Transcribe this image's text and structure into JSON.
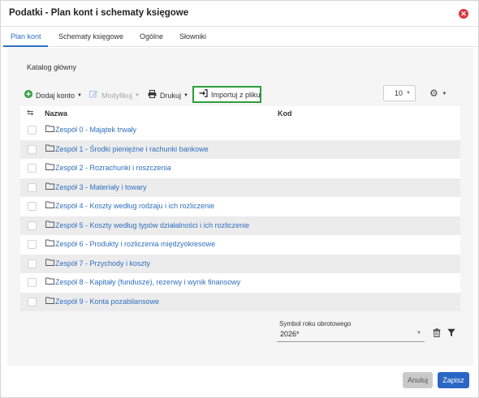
{
  "window": {
    "title": "Podatki - Plan kont i schematy księgowe",
    "close_icon": "close-circle-icon"
  },
  "tabs": [
    {
      "label": "Plan kont",
      "active": true
    },
    {
      "label": "Schematy księgowe",
      "active": false
    },
    {
      "label": "Ogólne",
      "active": false
    },
    {
      "label": "Słowniki",
      "active": false
    }
  ],
  "breadcrumb": "Katalog główny",
  "toolbar": {
    "add_label": "Dodaj konto",
    "edit_label": "Modyfikuj",
    "print_label": "Drukuj",
    "import_label": "Importuj z pliku",
    "per_page": "10",
    "colors": {
      "add_icon": "#2e9d3e",
      "import_highlight": "#2e9d3e"
    }
  },
  "table": {
    "columns": {
      "name": "Nazwa",
      "code": "Kod"
    },
    "rows": [
      {
        "name": "Zespół 0 - Majątek trwały",
        "code": ""
      },
      {
        "name": "Zespół 1 - Środki pieniężne i rachunki bankowe",
        "code": ""
      },
      {
        "name": "Zespół 2 - Rozrachunki i roszczenia",
        "code": ""
      },
      {
        "name": "Zespół 3 - Materiały i towary",
        "code": ""
      },
      {
        "name": "Zespół 4 - Koszty według rodzaju i ich rozliczenie",
        "code": ""
      },
      {
        "name": "Zespół 5 - Koszty według typów działalności i ich rozliczenie",
        "code": ""
      },
      {
        "name": "Zespół 6 - Produkty i rozliczenia międzyokresowe",
        "code": ""
      },
      {
        "name": "Zespół 7 - Przychody i koszty",
        "code": ""
      },
      {
        "name": "Zespół 8 - Kapitały (fundusze), rezerwy i wynik finansowy",
        "code": ""
      },
      {
        "name": "Zespół 9 - Konta pozabilansowe",
        "code": ""
      }
    ]
  },
  "fiscal_year": {
    "label": "Symbol roku obrotowego",
    "value": "2026*"
  },
  "footer": {
    "cancel_label": "Anuluj",
    "save_label": "Zapisz"
  },
  "colors": {
    "accent": "#2a66c4",
    "link": "#2f6fbf",
    "close": "#d9363e"
  }
}
